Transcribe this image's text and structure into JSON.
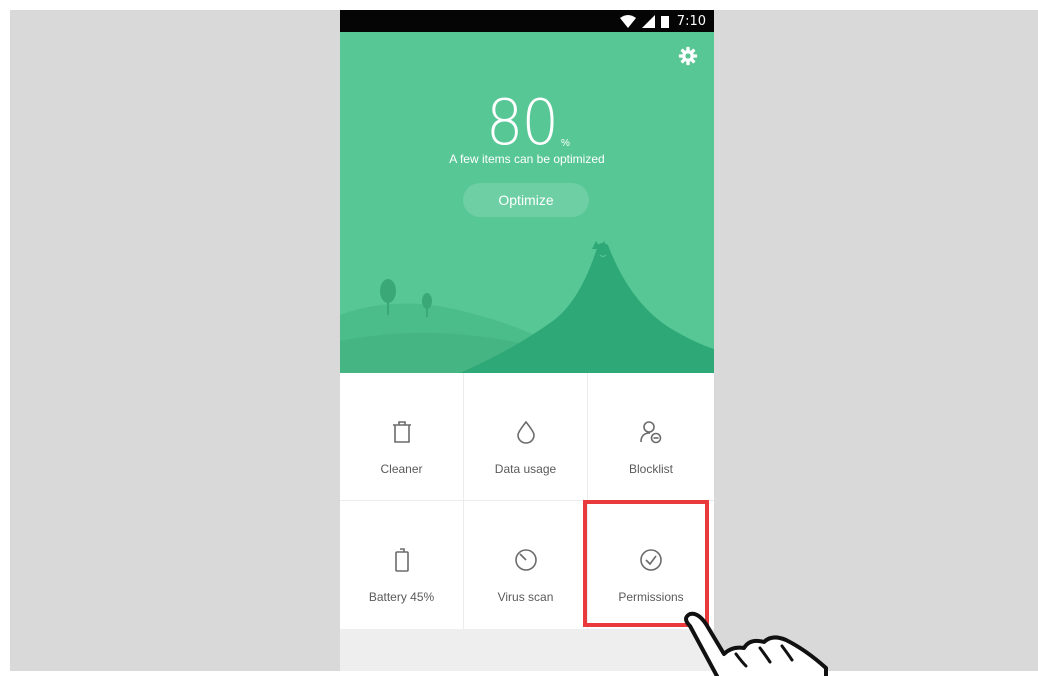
{
  "status_bar": {
    "time": "7:10",
    "icons": [
      "wifi-icon",
      "signal-icon",
      "battery-icon"
    ]
  },
  "header": {
    "score": "80",
    "score_unit": "%",
    "subtitle": "A few items can be optimized",
    "optimize_label": "Optimize",
    "settings_icon": "gear-icon"
  },
  "tools": [
    {
      "label": "Cleaner",
      "icon": "trash-icon"
    },
    {
      "label": "Data usage",
      "icon": "drop-icon"
    },
    {
      "label": "Blocklist",
      "icon": "person-block-icon"
    },
    {
      "label": "Battery 45%",
      "icon": "battery-icon"
    },
    {
      "label": "Virus scan",
      "icon": "radar-icon"
    },
    {
      "label": "Permissions",
      "icon": "check-circle-icon"
    }
  ],
  "annotation": {
    "highlight": "Permissions",
    "pointer_icon": "hand-pointer-icon"
  },
  "colors": {
    "hero_green": "#57c795",
    "hill_green": "#2fa878",
    "highlight_red": "#e8393c",
    "status_bar": "#050505"
  }
}
